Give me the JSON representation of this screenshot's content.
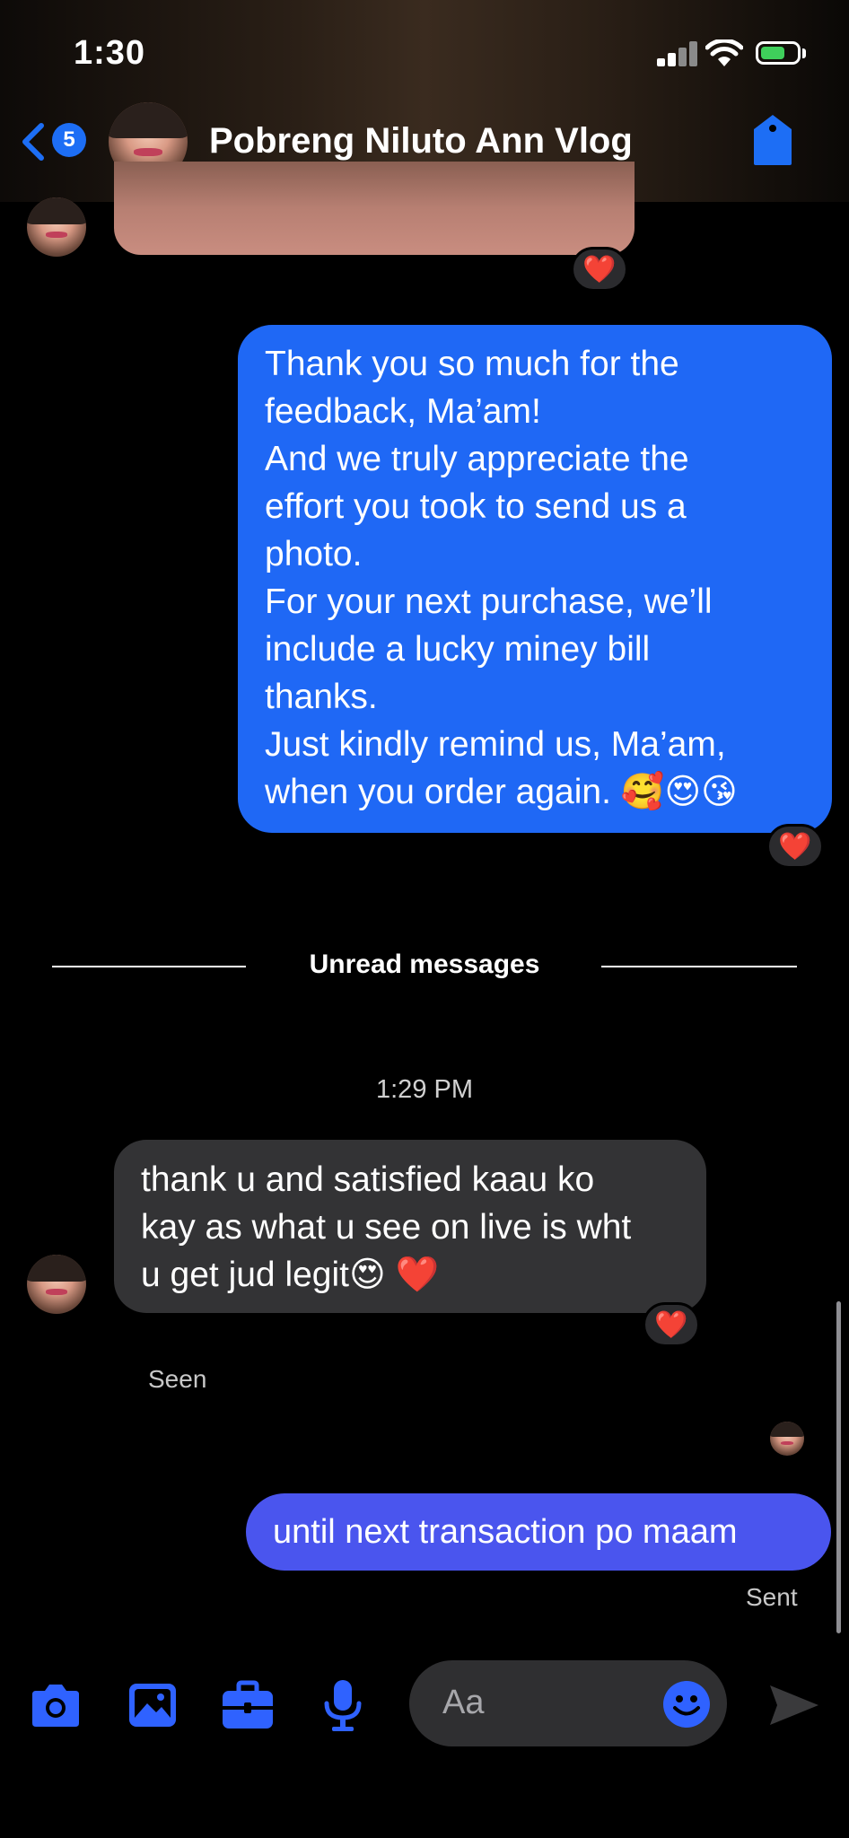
{
  "status_bar": {
    "time": "1:30"
  },
  "header": {
    "back_badge": "5",
    "contact_name": "Pobreng Niluto Ann Vlog"
  },
  "messages": {
    "outgoing_long": {
      "lines": [
        "Thank you so much for the",
        "feedback, Ma’am!",
        "And we truly appreciate the",
        "effort you took to send us a",
        "photo.",
        "For your next purchase, we’ll",
        "include a lucky miney bill",
        "thanks.",
        "Just kindly remind us, Ma’am,",
        "when you order again. 🥰😍😘"
      ],
      "reaction": "❤️"
    },
    "media_reaction": "❤️",
    "unread_divider": "Unread messages",
    "timestamp": "1:29 PM",
    "incoming": {
      "lines": [
        "thank u and satisfied kaau ko",
        "kay as what u see on live is wht",
        "u get jud legit😍 ❤️"
      ],
      "reaction": "❤️"
    },
    "seen_label": "Seen",
    "outgoing_short": "until next transaction po maam",
    "sent_label": "Sent"
  },
  "composer": {
    "placeholder": "Aa",
    "icons": [
      "camera-icon",
      "gallery-icon",
      "briefcase-icon",
      "microphone-icon",
      "emoji-icon",
      "send-icon"
    ]
  },
  "colors": {
    "outgoing_bubble": "#1f68f5",
    "outgoing_bubble_latest": "#4a55ee",
    "incoming_bubble": "#333335",
    "accent": "#2f62ff"
  }
}
